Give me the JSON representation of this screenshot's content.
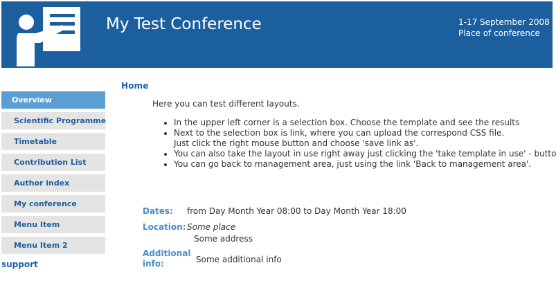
{
  "header": {
    "title": "My Test Conference",
    "dates": "1-17 September 2008",
    "place": "Place of conference",
    "colors": {
      "banner": "#1c5f9f"
    },
    "logo_icon": "presenter-icon"
  },
  "sidebar": {
    "items": [
      {
        "label": "Overview"
      },
      {
        "label": "Scientific Programme"
      },
      {
        "label": "Timetable"
      },
      {
        "label": "Contribution List"
      },
      {
        "label": "Author index"
      },
      {
        "label": "My conference"
      },
      {
        "label": "Menu Item"
      },
      {
        "label": "Menu Item 2"
      }
    ],
    "support": "support"
  },
  "main": {
    "heading": "Home",
    "intro": "Here you can test different layouts.",
    "bullets": [
      "In the upper left corner is a selection box. Choose the template and see the results",
      "Next to the selection box is link, where you can upload the correspond CSS file.",
      "Just click the right mouse button and choose 'save link as'.",
      "You can also take the layout in use right away just clicking the 'take template in use' - button.",
      "You can go back to management area, just using the link 'Back to management area'."
    ],
    "dates_label": "Dates:",
    "dates_value": "from Day Month Year 08:00 to Day Month Year 18:00",
    "location_label": "Location:",
    "location_place": "Some place",
    "location_address": "Some address",
    "additional_label_1": "Additional",
    "additional_label_2": "info:",
    "additional_value": "Some additional info"
  }
}
